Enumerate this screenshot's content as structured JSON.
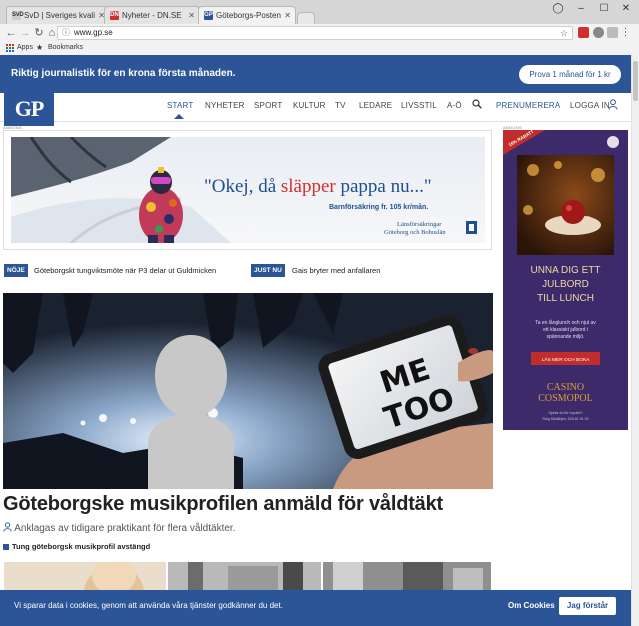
{
  "browser": {
    "tabs": [
      {
        "title": "SvD | Sveriges kvalitets",
        "favicon": "SvD",
        "active": false
      },
      {
        "title": "Nyheter - DN.SE",
        "favicon": "DN",
        "active": false
      },
      {
        "title": "Göteborgs-Posten",
        "favicon": "GP",
        "active": true
      }
    ],
    "url": "www.gp.se",
    "bookmarks": {
      "apps": "Apps",
      "bookmarks": "Bookmarks"
    }
  },
  "promo": {
    "text": "Riktig journalistik för en krona första månaden.",
    "button": "Prova 1 månad för 1 kr"
  },
  "site": {
    "logo": "GP",
    "nav": [
      "START",
      "NYHETER",
      "SPORT",
      "KULTUR",
      "TV",
      "LEDARE",
      "LIVSSTIL",
      "A-Ö"
    ],
    "subscribe": "PRENUMERERA",
    "login": "LOGGA IN"
  },
  "ads": {
    "label": "ANNONS",
    "top": {
      "headline_pre": "\"Okej, då ",
      "headline_emph": "släpper",
      "headline_post": " pappa nu...\"",
      "subline": "Barnförsäkring fr. 105 kr/mån.",
      "brand_line1": "Länsförsäkringar",
      "brand_line2": "Göteborg och Bohuslän"
    },
    "right": {
      "badge": "15% RABATT",
      "title": [
        "UNNA DIG ETT",
        "JULBORD",
        "TILL LUNCH"
      ],
      "body": [
        "Ta en långlunch och njut av",
        "ett klassiskt julbord i",
        "spännande miljö."
      ],
      "cta": "LÄS MER OCH BOKA",
      "brand_line1": "CASINO",
      "brand_line2": "COSMOPOL",
      "fine_line1": "Spelar du för mycket?",
      "fine_line2": "Ring Stödlinjen: 020-81 91 00"
    }
  },
  "ticker": [
    {
      "badge": "NÖJE",
      "text": "Göteborgskt tungviktsmöte när P3 delar ut Guldmicken"
    },
    {
      "badge": "JUST NU",
      "text": "Gais bryter med anfallaren"
    }
  ],
  "hero": {
    "phone_text_1": "ME",
    "phone_text_2": "TOO",
    "headline": "Göteborgske musikprofilen anmäld för våldtäkt",
    "subheadline": "Anklagas av tidigare praktikant för flera våldtäkter.",
    "related": "Tung göteborgsk musikprofil avstängd"
  },
  "cookie": {
    "message": "Vi sparar data i cookies, genom att använda våra tjänster godkänner du det.",
    "more": "Om Cookies",
    "accept": "Jag förstår"
  },
  "colors": {
    "brand": "#2b5596",
    "accent_red": "#d0302b"
  }
}
